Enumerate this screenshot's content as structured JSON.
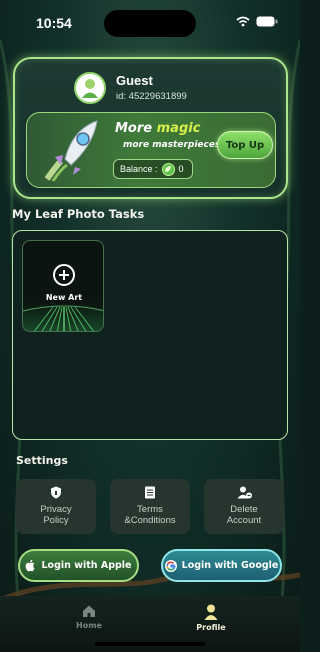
{
  "status_bar": {
    "time": "10:54"
  },
  "profile": {
    "name": "Guest",
    "id_label": "id: 45229631899"
  },
  "promo": {
    "title_prefix": "More ",
    "title_highlight": "magic",
    "subtitle": "more masterpieces",
    "balance_label": "Balance :",
    "balance_value": "0",
    "topup_label": "Top Up"
  },
  "tasks": {
    "title": "My Leaf Photo Tasks",
    "new_art_label": "New Art"
  },
  "settings": {
    "title": "Settings",
    "items": [
      {
        "label_line1": "Privacy",
        "label_line2": "Policy",
        "icon": "shield-icon"
      },
      {
        "label_line1": "Terms",
        "label_line2": "&Conditions",
        "icon": "document-icon"
      },
      {
        "label_line1": "Delete",
        "label_line2": "Account",
        "icon": "user-remove-icon"
      }
    ]
  },
  "login": {
    "apple_label": "Login with Apple",
    "google_label": "Login with Google"
  },
  "nav": {
    "home_label": "Home",
    "profile_label": "Profile"
  },
  "colors": {
    "accent_green": "#a9e68c",
    "magic_yellow": "#d6f24a",
    "google_teal": "#2f8b92"
  }
}
